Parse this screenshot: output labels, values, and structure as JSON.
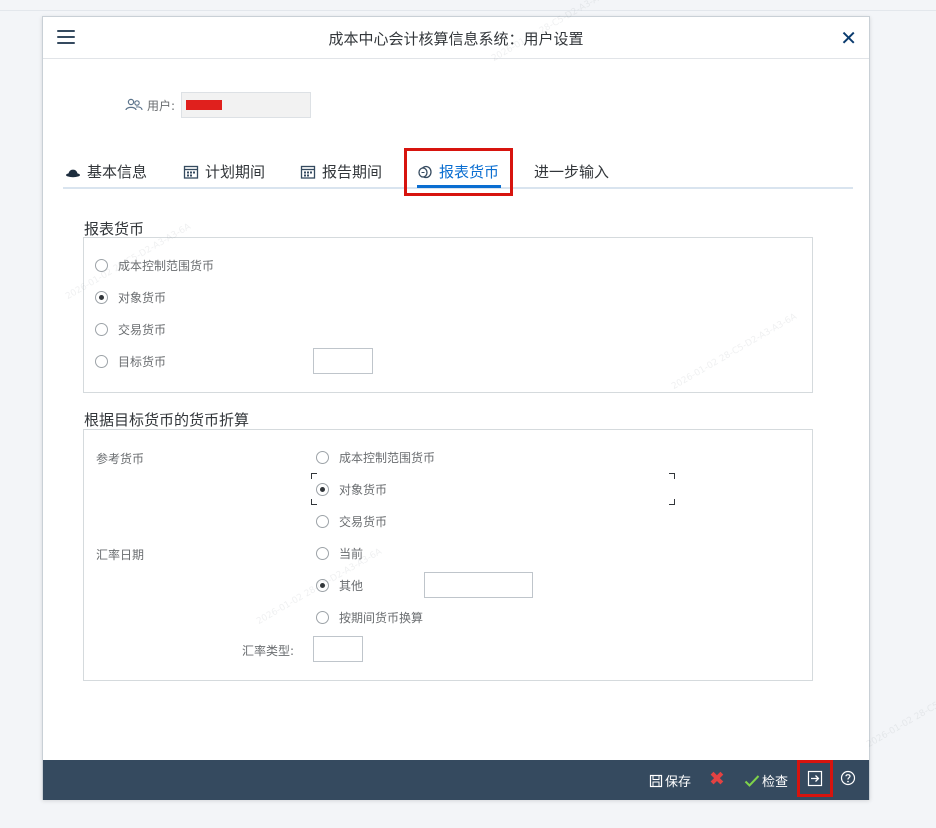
{
  "window": {
    "title": "成本中心会计核算信息系统：用户设置"
  },
  "user": {
    "label": "用户:"
  },
  "tabs": [
    {
      "label": "基本信息",
      "icon": "hat-icon"
    },
    {
      "label": "计划期间",
      "icon": "calendar-icon"
    },
    {
      "label": "报告期间",
      "icon": "calendar-icon"
    },
    {
      "label": "报表货币",
      "icon": "currency-icon",
      "active": true
    },
    {
      "label": "进一步输入"
    }
  ],
  "report_currency": {
    "title": "报表货币",
    "options": [
      {
        "label": "成本控制范围货币",
        "checked": false
      },
      {
        "label": "对象货币",
        "checked": true
      },
      {
        "label": "交易货币",
        "checked": false
      },
      {
        "label": "目标货币",
        "checked": false
      }
    ]
  },
  "conversion": {
    "title": "根据目标货币的货币折算",
    "reference_label": "参考货币",
    "reference_options": [
      {
        "label": "成本控制范围货币",
        "checked": false
      },
      {
        "label": "对象货币",
        "checked": true
      },
      {
        "label": "交易货币",
        "checked": false
      }
    ],
    "date_label": "汇率日期",
    "date_options": [
      {
        "label": "当前",
        "checked": false
      },
      {
        "label": "其他",
        "checked": true
      },
      {
        "label": "按期间货币换算",
        "checked": false
      }
    ],
    "rate_type_label": "汇率类型:"
  },
  "footer": {
    "save_label": "保存",
    "check_label": "检查"
  },
  "watermark": "2026-01-02 28-C5-D2-A3-A3-6A",
  "colors": {
    "accent": "#0a6ed1",
    "footer": "#354a5f",
    "highlight": "#d7140e"
  }
}
